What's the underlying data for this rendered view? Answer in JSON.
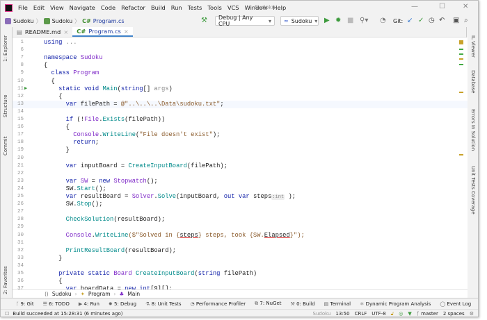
{
  "app": {
    "title": "Sudoku",
    "menu": [
      "File",
      "Edit",
      "View",
      "Navigate",
      "Code",
      "Refactor",
      "Build",
      "Run",
      "Tests",
      "Tools",
      "VCS",
      "Window",
      "Help"
    ]
  },
  "nav": {
    "crumbs": [
      "Sudoku",
      "Sudoku",
      "Program.cs"
    ],
    "config": "Debug | Any CPU",
    "run_target": "Sudoku",
    "git_label": "Git:"
  },
  "tabs": [
    {
      "label": "README.md",
      "active": false
    },
    {
      "label": "Program.cs",
      "active": true,
      "prefix": "C#"
    }
  ],
  "left_tools": [
    "1: Explorer",
    "Structure",
    "Commit",
    "2: Favorites"
  ],
  "right_tools": [
    "IL Viewer",
    "Database",
    "Errors In Solution",
    "Unit Tests Coverage"
  ],
  "code": [
    {
      "n": "1",
      "t": [
        [
          "using ",
          "kw"
        ],
        [
          "...",
          "gr"
        ]
      ]
    },
    {
      "n": "6",
      "t": []
    },
    {
      "n": "7",
      "t": [
        [
          "namespace ",
          "kw"
        ],
        [
          "Sudoku",
          "ty"
        ]
      ]
    },
    {
      "n": "8",
      "t": [
        [
          "{",
          "pl"
        ]
      ]
    },
    {
      "n": "9",
      "t": [
        [
          "  class ",
          "kw"
        ],
        [
          "Program",
          "ty"
        ]
      ]
    },
    {
      "n": "10",
      "t": [
        [
          "  {",
          "pl"
        ]
      ]
    },
    {
      "n": "11",
      "t": [
        [
          "    static void ",
          "kw"
        ],
        [
          "Main",
          "fn"
        ],
        [
          "(",
          "pl"
        ],
        [
          "string",
          "kw"
        ],
        [
          "[] ",
          "pl"
        ],
        [
          "args",
          "gr"
        ],
        [
          ")",
          "pl"
        ]
      ],
      "run": true
    },
    {
      "n": "12",
      "t": [
        [
          "    {",
          "pl"
        ]
      ]
    },
    {
      "n": "13",
      "t": [
        [
          "      var ",
          "kw"
        ],
        [
          "filePath = ",
          "pl"
        ],
        [
          "@\"..\\..\\..\\Data\\sudoku.txt\"",
          "st"
        ],
        [
          ";",
          "pl"
        ]
      ],
      "current": true
    },
    {
      "n": "14",
      "t": []
    },
    {
      "n": "15",
      "t": [
        [
          "      if ",
          "kw"
        ],
        [
          "(!",
          "pl"
        ],
        [
          "File",
          "ty"
        ],
        [
          ".",
          "pl"
        ],
        [
          "Exists",
          "fn"
        ],
        [
          "(filePath))",
          "pl"
        ]
      ]
    },
    {
      "n": "16",
      "t": [
        [
          "      {",
          "pl"
        ]
      ]
    },
    {
      "n": "17",
      "t": [
        [
          "        Console",
          "ty"
        ],
        [
          ".",
          "pl"
        ],
        [
          "WriteLine",
          "fn"
        ],
        [
          "(",
          "pl"
        ],
        [
          "\"File doesn't exist\"",
          "st"
        ],
        [
          ");",
          "pl"
        ]
      ]
    },
    {
      "n": "18",
      "t": [
        [
          "        return",
          "kw"
        ],
        [
          ";",
          "pl"
        ]
      ]
    },
    {
      "n": "19",
      "t": [
        [
          "      }",
          "pl"
        ]
      ]
    },
    {
      "n": "20",
      "t": []
    },
    {
      "n": "21",
      "t": [
        [
          "      var ",
          "kw"
        ],
        [
          "inputBoard = ",
          "pl"
        ],
        [
          "CreateInputBoard",
          "fn"
        ],
        [
          "(filePath);",
          "pl"
        ]
      ]
    },
    {
      "n": "22",
      "t": []
    },
    {
      "n": "23",
      "t": [
        [
          "      var ",
          "kw"
        ],
        [
          "SW",
          "ty"
        ],
        [
          " = ",
          "pl"
        ],
        [
          "new ",
          "kw"
        ],
        [
          "Stopwatch",
          "ty"
        ],
        [
          "();",
          "pl"
        ]
      ]
    },
    {
      "n": "24",
      "t": [
        [
          "      SW.",
          "pl"
        ],
        [
          "Start",
          "fn"
        ],
        [
          "();",
          "pl"
        ]
      ]
    },
    {
      "n": "25",
      "t": [
        [
          "      var ",
          "kw"
        ],
        [
          "resultBoard = ",
          "pl"
        ],
        [
          "Solver",
          "ty"
        ],
        [
          ".",
          "pl"
        ],
        [
          "Solve",
          "fn"
        ],
        [
          "(inputBoard, ",
          "pl"
        ],
        [
          "out var ",
          "kw"
        ],
        [
          "steps",
          "pl"
        ],
        [
          ":int",
          "hint"
        ],
        [
          " );",
          "pl"
        ]
      ]
    },
    {
      "n": "26",
      "t": [
        [
          "      SW.",
          "pl"
        ],
        [
          "Stop",
          "fn"
        ],
        [
          "();",
          "pl"
        ]
      ]
    },
    {
      "n": "27",
      "t": []
    },
    {
      "n": "28",
      "t": [
        [
          "      CheckSolution",
          "fn"
        ],
        [
          "(resultBoard);",
          "pl"
        ]
      ]
    },
    {
      "n": "29",
      "t": []
    },
    {
      "n": "30",
      "t": [
        [
          "      Console",
          "ty"
        ],
        [
          ".",
          "pl"
        ],
        [
          "WriteLine",
          "fn"
        ],
        [
          "($\"Solved in {",
          "st"
        ],
        [
          "steps",
          "ue"
        ],
        [
          "} steps, took {SW.",
          "st"
        ],
        [
          "Elapsed",
          "ue"
        ],
        [
          "}\");",
          "st"
        ]
      ]
    },
    {
      "n": "31",
      "t": []
    },
    {
      "n": "32",
      "t": [
        [
          "      PrintResultBoard",
          "fn"
        ],
        [
          "(resultBoard);",
          "pl"
        ]
      ]
    },
    {
      "n": "33",
      "t": [
        [
          "    }",
          "pl"
        ]
      ]
    },
    {
      "n": "34",
      "t": []
    },
    {
      "n": "35",
      "t": [
        [
          "    private static ",
          "kw"
        ],
        [
          "Board ",
          "ty"
        ],
        [
          "CreateInputBoard",
          "fn"
        ],
        [
          "(",
          "pl"
        ],
        [
          "string ",
          "kw"
        ],
        [
          "filePath)",
          "pl"
        ]
      ]
    },
    {
      "n": "36",
      "t": [
        [
          "    {",
          "pl"
        ]
      ]
    },
    {
      "n": "37",
      "t": [
        [
          "      var ",
          "kw"
        ],
        [
          "boardData = ",
          "pl"
        ],
        [
          "new int",
          "kw"
        ],
        [
          "[9][];",
          "pl"
        ]
      ]
    }
  ],
  "breadcrumb": [
    "Sudoku",
    "Program",
    "Main"
  ],
  "tool_windows": [
    "9: Git",
    "6: TODO",
    "4: Run",
    "5: Debug",
    "8: Unit Tests",
    "Performance Profiler",
    "7: NuGet",
    "0: Build",
    "Terminal",
    "Dynamic Program Analysis",
    "Event Log"
  ],
  "status": {
    "message": "Build succeeded at 15:28:31 (6 minutes ago)",
    "project": "Sudoku",
    "position": "13:50",
    "line_ending": "CRLF",
    "encoding": "UTF-8",
    "branch": "master",
    "indent": "2 spaces"
  },
  "colors": {
    "accent": "#4083c9",
    "run_green": "#3b9a3b",
    "keyword": "#0f1fa8",
    "type": "#7f2ac8"
  }
}
